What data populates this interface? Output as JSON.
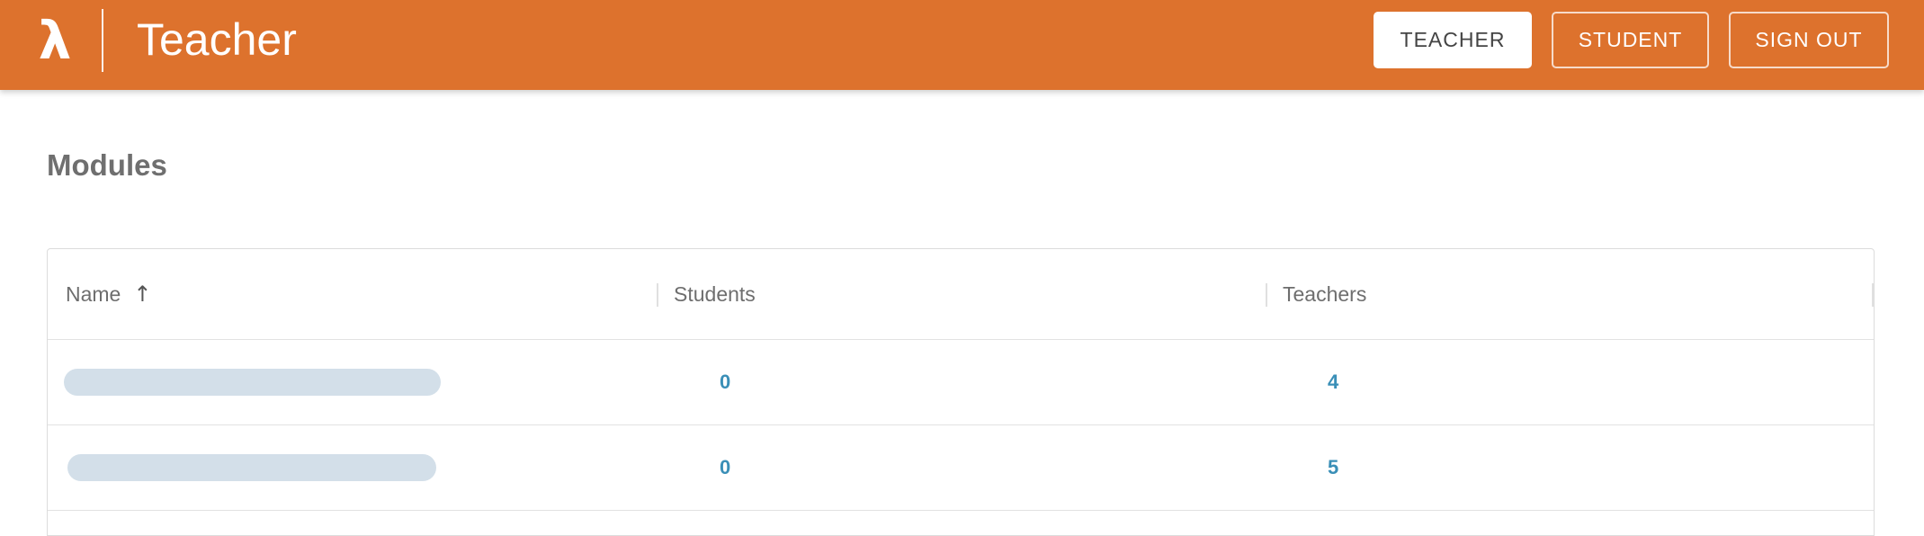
{
  "header": {
    "logo_glyph": "λ",
    "title": "Teacher",
    "background_color": "#dd722d",
    "nav": {
      "teacher": "TEACHER",
      "student": "STUDENT",
      "sign_out": "SIGN OUT"
    },
    "active_nav": "teacher"
  },
  "main": {
    "title": "Modules",
    "table": {
      "columns": {
        "name": "Name",
        "students": "Students",
        "teachers": "Teachers"
      },
      "sort": {
        "column": "name",
        "direction": "ascending",
        "icon": "arrow-up-icon"
      },
      "rows": [
        {
          "name": "",
          "students": "0",
          "teachers": "4"
        },
        {
          "name": "",
          "students": "0",
          "teachers": "5"
        }
      ],
      "link_color": "#3a8fb7"
    }
  }
}
